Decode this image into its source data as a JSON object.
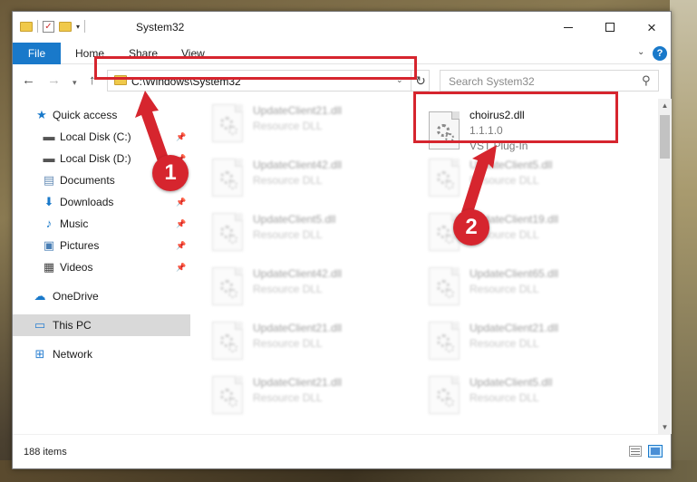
{
  "window": {
    "title": "System32",
    "controls": {
      "minimize": "min",
      "maximize": "max",
      "close": "×"
    }
  },
  "ribbon": {
    "tabs": [
      "File",
      "Home",
      "Share",
      "View"
    ]
  },
  "navbar": {
    "address": "C:\\Windows\\System32",
    "search_placeholder": "Search System32"
  },
  "navpane": {
    "items": [
      {
        "label": "Quick access",
        "icon": "star-icon",
        "pinned": false
      },
      {
        "label": "Local Disk (C:)",
        "icon": "drive-icon",
        "pinned": true
      },
      {
        "label": "Local Disk (D:)",
        "icon": "drive-icon",
        "pinned": true
      },
      {
        "label": "Documents",
        "icon": "documents-icon",
        "pinned": true
      },
      {
        "label": "Downloads",
        "icon": "downloads-icon",
        "pinned": true
      },
      {
        "label": "Music",
        "icon": "music-icon",
        "pinned": true
      },
      {
        "label": "Pictures",
        "icon": "pictures-icon",
        "pinned": true
      },
      {
        "label": "Videos",
        "icon": "videos-icon",
        "pinned": true
      },
      {
        "label": "OneDrive",
        "icon": "cloud-icon",
        "pinned": false
      },
      {
        "label": "This PC",
        "icon": "computer-icon",
        "pinned": false
      },
      {
        "label": "Network",
        "icon": "network-icon",
        "pinned": false
      }
    ]
  },
  "files": {
    "highlighted": {
      "name": "choirus2.dll",
      "version": "1.1.1.0",
      "type": "VST Plug-In"
    },
    "left_column": [
      {
        "name": "UpdateClient21.dll",
        "type": "Resource DLL"
      },
      {
        "name": "UpdateClient42.dll",
        "type": "Resource DLL"
      },
      {
        "name": "UpdateClient5.dll",
        "type": "Resource DLL"
      },
      {
        "name": "UpdateClient42.dll",
        "type": "Resource DLL"
      },
      {
        "name": "UpdateClient21.dll",
        "type": "Resource DLL"
      },
      {
        "name": "UpdateClient21.dll",
        "type": "Resource DLL"
      }
    ],
    "right_column": [
      {
        "name": "UpdateClient5.dll",
        "type": "Resource DLL"
      },
      {
        "name": "UpdateClient19.dll",
        "type": "Resource DLL"
      },
      {
        "name": "UpdateClient65.dll",
        "type": "Resource DLL"
      },
      {
        "name": "UpdateClient21.dll",
        "type": "Resource DLL"
      },
      {
        "name": "UpdateClient5.dll",
        "type": "Resource DLL"
      }
    ]
  },
  "status": {
    "item_count": "188 items"
  },
  "callouts": [
    "1",
    "2"
  ],
  "colors": {
    "accent": "#1979ca",
    "highlight_red": "#d6252e",
    "selected_bg": "#cce8ff"
  }
}
